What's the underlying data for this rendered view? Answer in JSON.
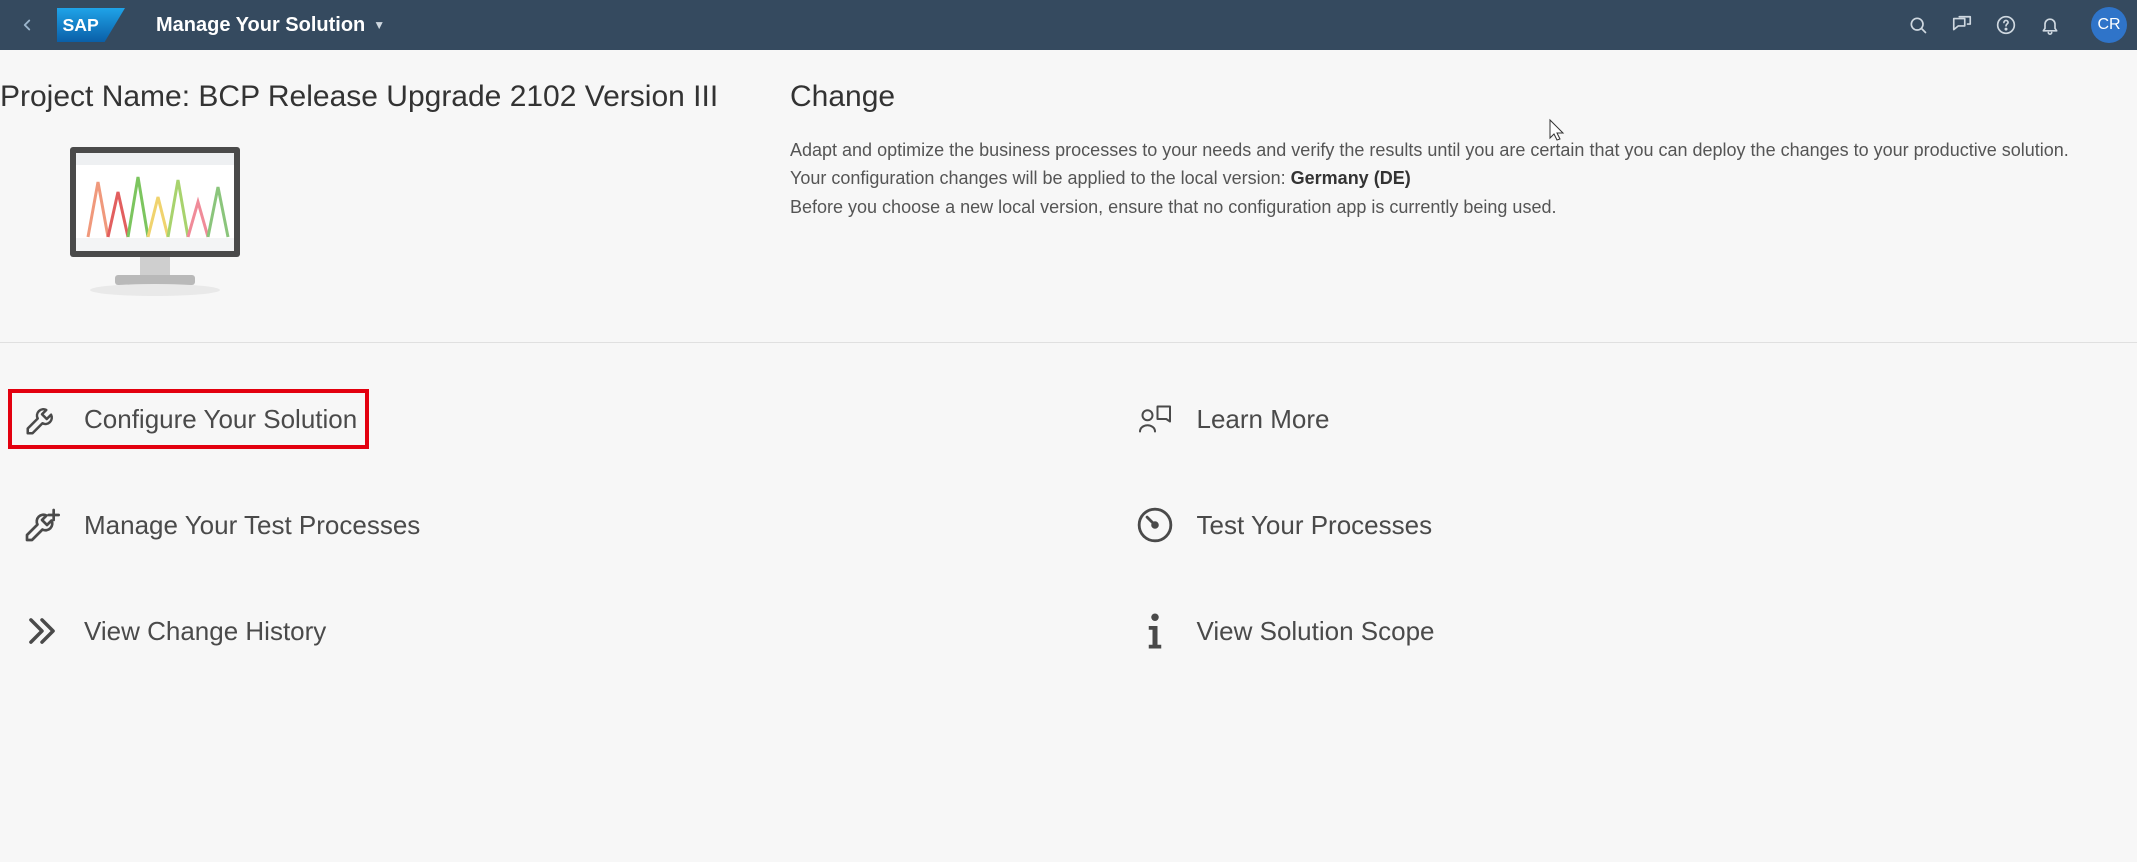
{
  "header": {
    "app_title": "Manage Your Solution",
    "avatar_initials": "CR"
  },
  "project": {
    "title": "Project Name: BCP Release Upgrade 2102 Version III"
  },
  "change": {
    "heading": "Change",
    "desc1": "Adapt and optimize the business processes to your needs and verify the results until you are certain that you can deploy the changes to your productive solution.",
    "desc2_prefix": "Your configuration changes will be applied to the local version:  ",
    "desc2_bold": "Germany (DE)",
    "desc3": "Before you choose a new local version, ensure that no configuration app is currently being used."
  },
  "tiles": {
    "configure": "Configure Your Solution",
    "learn_more": "Learn More",
    "manage_tests": "Manage Your Test Processes",
    "test_processes": "Test Your Processes",
    "change_history": "View Change History",
    "solution_scope": "View Solution Scope"
  }
}
